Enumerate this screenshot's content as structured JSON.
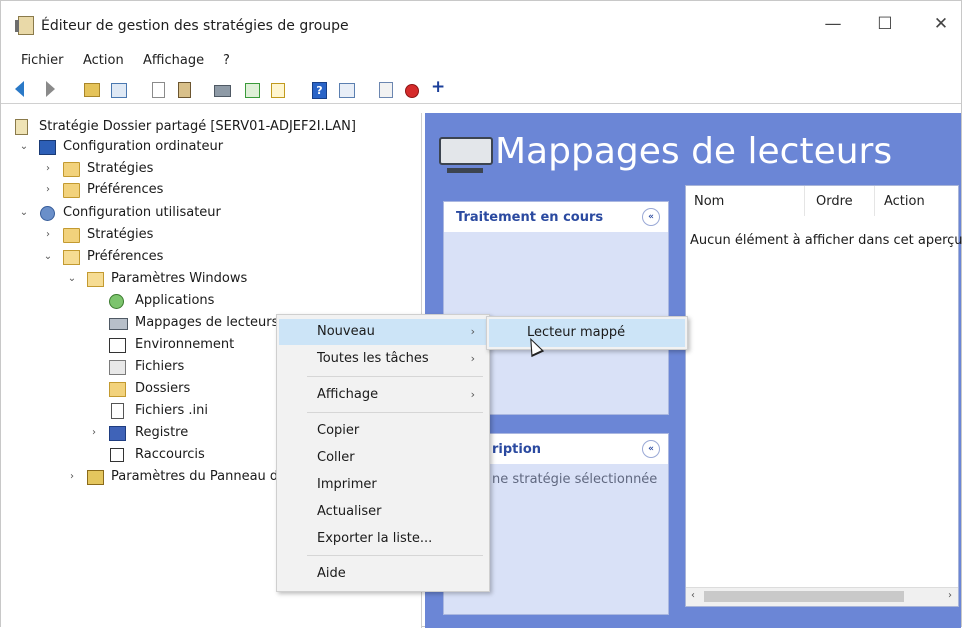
{
  "window": {
    "title": "Éditeur de gestion des stratégies de groupe",
    "minimize": "—",
    "maximize": "☐",
    "close": "✕"
  },
  "menu": [
    "Fichier",
    "Action",
    "Affichage",
    "?"
  ],
  "toolbar_icons": [
    "back-icon",
    "forward-icon",
    "folder-up-icon",
    "show-hide-tree-icon",
    "copy-icon",
    "paste-icon",
    "print-icon",
    "refresh-icon",
    "export-list-icon",
    "help-icon",
    "properties-icon",
    "scan-icon",
    "stop-icon",
    "add-icon"
  ],
  "tree": {
    "root": "Stratégie Dossier partagé [SERV01-ADJEF2I.LAN]",
    "computer_config": "Configuration ordinateur",
    "cc_strategies": "Stratégies",
    "cc_preferences": "Préférences",
    "user_config": "Configuration utilisateur",
    "uc_strategies": "Stratégies",
    "uc_preferences": "Préférences",
    "windows_params": "Paramètres Windows",
    "applications": "Applications",
    "drive_maps": "Mappages de lecteurs",
    "environment": "Environnement",
    "files": "Fichiers",
    "folders": "Dossiers",
    "ini_files": "Fichiers .ini",
    "registry": "Registre",
    "shortcuts": "Raccourcis",
    "control_panel": "Paramètres du Panneau d"
  },
  "right": {
    "title": "Mappages de lecteurs",
    "processing_title": "Traitement en cours",
    "description_title": "ription",
    "description_text": "ne stratégie sélectionnée",
    "collapse_glyph": "«",
    "columns": [
      "Nom",
      "Ordre",
      "Action"
    ],
    "empty_message": "Aucun élément à afficher dans cet aperçu.",
    "scroll_left": "‹",
    "scroll_right": "›"
  },
  "context_menu": {
    "new": "Nouveau",
    "all_tasks": "Toutes les tâches",
    "view": "Affichage",
    "copy": "Copier",
    "paste": "Coller",
    "print": "Imprimer",
    "refresh": "Actualiser",
    "export": "Exporter la liste...",
    "help": "Aide",
    "arrow": "›"
  },
  "submenu": {
    "mapped_drive": "Lecteur mappé"
  },
  "colors": {
    "right_pane_bg": "#6b86d6",
    "menu_highlight": "#cce4f7",
    "panel_title": "#2b4aa0"
  }
}
